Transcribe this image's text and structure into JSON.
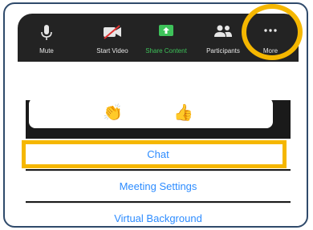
{
  "toolbar": {
    "mute_label": "Mute",
    "start_video_label": "Start Video",
    "share_content_label": "Share Content",
    "participants_label": "Participants",
    "more_label": "More"
  },
  "reactions": {
    "clap": "👏",
    "thumbs_up": "👍"
  },
  "menu": {
    "items": [
      {
        "label": "Chat"
      },
      {
        "label": "Meeting Settings"
      },
      {
        "label": "Virtual Background"
      }
    ]
  },
  "colors": {
    "toolbar_bg": "#232323",
    "share_green": "#3ec25a",
    "menu_text_blue": "#2d8cff",
    "highlight_yellow": "#f5b700",
    "video_off_red": "#e0302f"
  },
  "icons": [
    "microphone-icon",
    "video-off-icon",
    "share-screen-icon",
    "participants-icon",
    "more-dots-icon"
  ]
}
